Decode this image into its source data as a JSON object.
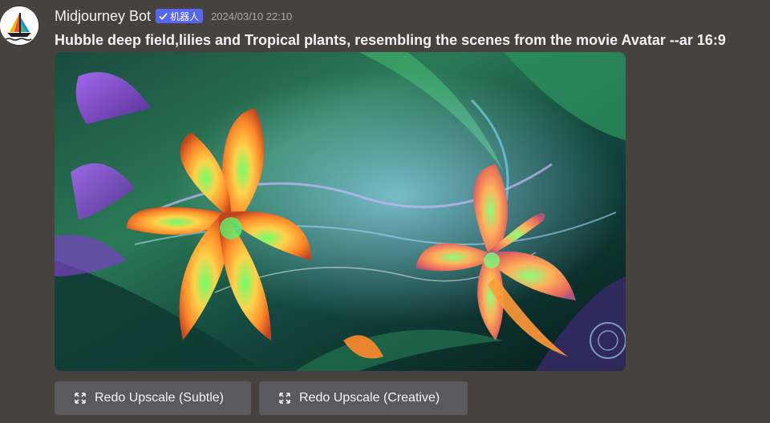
{
  "message": {
    "author": "Midjourney Bot",
    "bot_tag": "机器人",
    "timestamp": "2024/03/10 22:10",
    "prompt": "Hubble deep field,lilies and Tropical plants, resembling the scenes from the movie Avatar --ar 16:9"
  },
  "buttons": {
    "redo_subtle": "Redo Upscale (Subtle)",
    "redo_creative": "Redo Upscale (Creative)"
  },
  "icons": {
    "avatar": "sailboat-logo-icon",
    "bot_check": "checkmark-icon",
    "button_icon": "expand-arrows-icon"
  },
  "colors": {
    "background": "#46423d",
    "bot_tag": "#5865f2",
    "button": "#5a5a5e",
    "timestamp": "#a8aaaf"
  }
}
